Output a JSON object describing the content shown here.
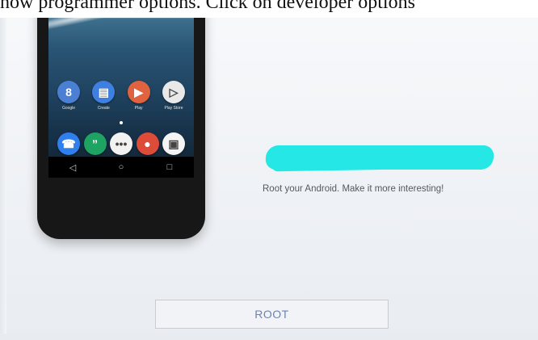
{
  "caption": {
    "text": "how programmer options. Click on developer options"
  },
  "phone": {
    "apps": [
      {
        "label": "Google",
        "glyph": "8",
        "color": "#4a7fd4",
        "icon": "google-folder-icon"
      },
      {
        "label": "Create",
        "glyph": "▤",
        "color": "#3f7fe0",
        "icon": "create-folder-icon"
      },
      {
        "label": "Play",
        "glyph": "▶",
        "color": "#e0623f",
        "icon": "play-folder-icon"
      },
      {
        "label": "Play Store",
        "glyph": "▷",
        "color": "#e9e9e9",
        "icon": "play-store-icon"
      }
    ],
    "dock": [
      {
        "glyph": "☎",
        "color": "#2f80ed",
        "icon": "phone-icon"
      },
      {
        "glyph": "”",
        "color": "#1ea362",
        "icon": "hangouts-icon"
      },
      {
        "glyph": "•••",
        "color": "#f2f2f2",
        "icon": "app-drawer-icon"
      },
      {
        "glyph": "●",
        "color": "#dd4b39",
        "icon": "chrome-icon"
      },
      {
        "glyph": "▣",
        "color": "#f4f4f4",
        "icon": "camera-icon"
      }
    ],
    "nav": {
      "back": "◁",
      "home": "○",
      "recents": "□"
    }
  },
  "promo": {
    "tagline": "Root your Android. Make it more interesting!",
    "redaction_color": "#25e8e6"
  },
  "actions": {
    "root_label": "ROOT"
  },
  "colors": {
    "accent_text": "#6b83b7"
  }
}
